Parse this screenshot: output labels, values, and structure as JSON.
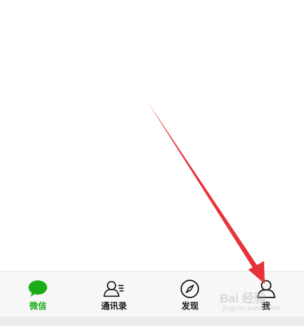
{
  "tab_bar": {
    "active_color": "#1aad19",
    "inactive_color": "#191919",
    "tabs": [
      {
        "label": "微信",
        "icon": "chat-bubble-icon",
        "active": true
      },
      {
        "label": "通讯录",
        "icon": "contacts-icon",
        "active": false
      },
      {
        "label": "发现",
        "icon": "compass-icon",
        "active": false
      },
      {
        "label": "我",
        "icon": "person-icon",
        "active": false
      }
    ]
  },
  "annotation": {
    "arrow_color": "#e8323a",
    "points_to": "tab-me"
  },
  "watermark": {
    "text": "Bai 经验",
    "sub": "jingyan.baidu.com"
  }
}
